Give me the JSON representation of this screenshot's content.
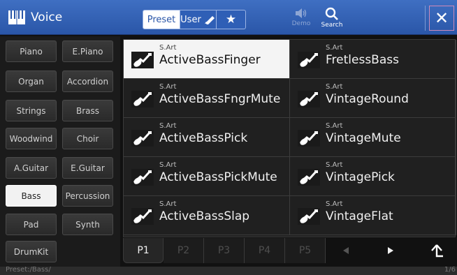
{
  "header": {
    "title": "Voice",
    "tabs": {
      "preset": "Preset",
      "user": "User"
    },
    "demo_label": "Demo",
    "search_label": "Search",
    "close_symbol": "✕",
    "accent": "#2a56a8"
  },
  "categories": [
    "Piano",
    "E.Piano",
    "Organ",
    "Accordion",
    "Strings",
    "Brass",
    "Woodwind",
    "Choir",
    "A.Guitar",
    "E.Guitar",
    "Bass",
    "Percussion",
    "Pad",
    "Synth",
    "DrumKit"
  ],
  "selected_category": "Bass",
  "voices": [
    {
      "tag": "S.Art",
      "name": "ActiveBassFinger",
      "selected": true
    },
    {
      "tag": "S.Art",
      "name": "FretlessBass"
    },
    {
      "tag": "S.Art",
      "name": "ActiveBassFngrMute"
    },
    {
      "tag": "S.Art",
      "name": "VintageRound"
    },
    {
      "tag": "S.Art",
      "name": "ActiveBassPick"
    },
    {
      "tag": "S.Art",
      "name": "VintageMute"
    },
    {
      "tag": "S.Art",
      "name": "ActiveBassPickMute"
    },
    {
      "tag": "S.Art",
      "name": "VintagePick"
    },
    {
      "tag": "S.Art",
      "name": "ActiveBassSlap"
    },
    {
      "tag": "S.Art",
      "name": "VintageFlat"
    }
  ],
  "pages": [
    "P1",
    "P2",
    "P3",
    "P4",
    "P5"
  ],
  "active_page": "P1",
  "status": {
    "path": "Preset:/Bass/",
    "page": "1/6"
  }
}
